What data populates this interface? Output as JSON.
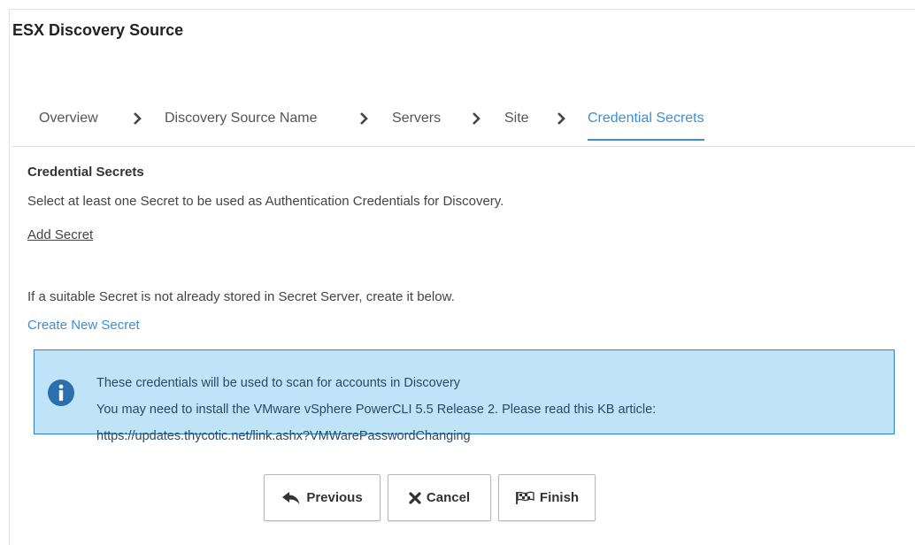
{
  "page": {
    "title": "ESX Discovery Source"
  },
  "wizard": {
    "steps": [
      {
        "label": "Overview"
      },
      {
        "label": "Discovery Source Name"
      },
      {
        "label": "Servers"
      },
      {
        "label": "Site"
      },
      {
        "label": "Credential Secrets"
      }
    ],
    "active_step": "Credential Secrets"
  },
  "content": {
    "section_title": "Credential Secrets",
    "instruction": "Select at least one Secret to be used as Authentication Credentials for Discovery.",
    "add_secret_link": "Add Secret",
    "hint": "If a suitable Secret is not already stored in Secret Server, create it below.",
    "create_secret_link": "Create New Secret"
  },
  "info_box": {
    "icon": "info-icon",
    "lines": [
      "These credentials will be used to scan for accounts in Discovery",
      "You may need to install the VMware vSphere PowerCLI 5.5 Release 2. Please read this KB article:",
      "https://updates.thycotic.net/link.ashx?VMWarePasswordChanging"
    ]
  },
  "buttons": {
    "previous": {
      "label": "Previous",
      "icon": "reply-arrow-icon"
    },
    "cancel": {
      "label": "Cancel",
      "icon": "x-icon"
    },
    "finish": {
      "label": "Finish",
      "icon": "checkered-flag-icon"
    }
  },
  "colors": {
    "accent": "#3a8fd6",
    "info_bg": "#bfe4f7",
    "info_border": "#2e7fbf",
    "info_icon": "#2b6fad"
  }
}
